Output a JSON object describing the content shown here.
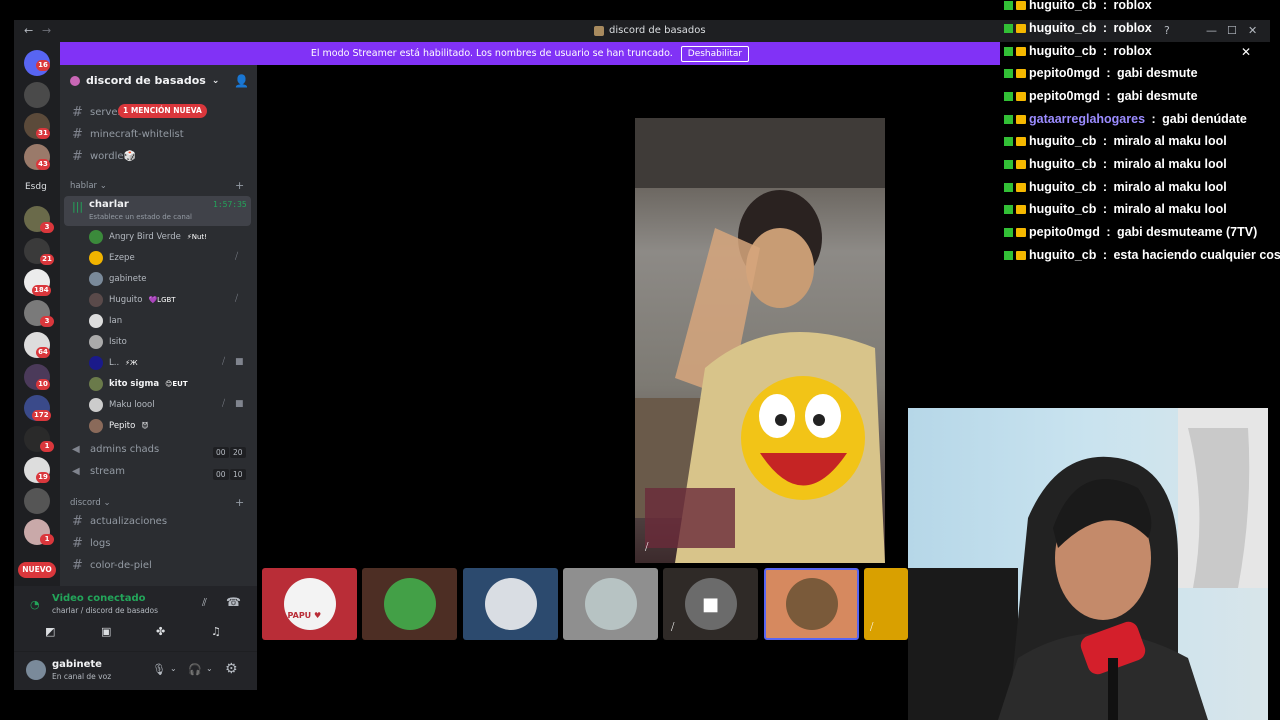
{
  "window": {
    "title": "discord de basados"
  },
  "streamer_banner": {
    "text": "El modo Streamer está habilitado. Los nombres de usuario se han truncado.",
    "button": "Deshabilitar"
  },
  "guilds": [
    {
      "badge": "16"
    },
    {
      "badge": ""
    },
    {
      "badge": "31"
    },
    {
      "badge": "43"
    },
    {
      "label": "Esdg"
    },
    {
      "badge": "3"
    },
    {
      "badge": "21"
    },
    {
      "badge": "184"
    },
    {
      "badge": "3"
    },
    {
      "badge": "64"
    },
    {
      "badge": "10"
    },
    {
      "badge": "172"
    },
    {
      "badge": "1"
    },
    {
      "badge": "19"
    },
    {
      "badge": ""
    },
    {
      "badge": "1"
    }
  ],
  "new_label": "NUEVO",
  "server": {
    "name": "discord de basados",
    "mention_badge": "1 MENCIÓN NUEVA",
    "channels_top": [
      {
        "name": "server"
      },
      {
        "name": "minecraft-whitelist"
      },
      {
        "name": "wordle🎲"
      }
    ],
    "cat_hablar": "hablar",
    "voice_active": {
      "name": "charlar",
      "status": "Establece un estado de canal",
      "timer": "1:57:35"
    },
    "voice_users": [
      {
        "name": "Angry Bird Verde",
        "tag": "⚡Nut!",
        "muted": true
      },
      {
        "name": "Ezepe",
        "tag": "",
        "muted": true
      },
      {
        "name": "gabinete",
        "tag": ""
      },
      {
        "name": "Huguito",
        "tag": "💜LGBT",
        "muted": true
      },
      {
        "name": "Ian",
        "tag": ""
      },
      {
        "name": "Isito",
        "tag": ""
      },
      {
        "name": "L..",
        "tag": "⚡Ж",
        "muted": true
      },
      {
        "name": "kito sigma",
        "tag": "😊EUT"
      },
      {
        "name": "Maku loool",
        "tag": "",
        "muted": true
      },
      {
        "name": "Pepito",
        "tag": "😈"
      }
    ],
    "voice_channels": [
      {
        "name": "admins chads",
        "a": "00",
        "b": "20"
      },
      {
        "name": "stream",
        "a": "00",
        "b": "10"
      }
    ],
    "cat_discord": "discord",
    "channels_bottom": [
      {
        "name": "actualizaciones"
      },
      {
        "name": "logs"
      },
      {
        "name": "color-de-piel"
      }
    ]
  },
  "voice_panel": {
    "status": "Video conectado",
    "location": "charlar / discord de basados"
  },
  "user_panel": {
    "name": "gabinete",
    "status": "En canal de voz"
  },
  "chat": [
    {
      "user": "huguito_cb",
      "msg": "roblox"
    },
    {
      "user": "huguito_cb",
      "msg": "roblox"
    },
    {
      "user": "huguito_cb",
      "msg": "roblox"
    },
    {
      "user": "pepito0mgd",
      "msg": "gabi desmute"
    },
    {
      "user": "pepito0mgd",
      "msg": "gabi desmute"
    },
    {
      "user": "gataarreglahogares",
      "msg": "gabi denúdate"
    },
    {
      "user": "huguito_cb",
      "msg": "miralo al maku lool"
    },
    {
      "user": "huguito_cb",
      "msg": "miralo al maku lool"
    },
    {
      "user": "huguito_cb",
      "msg": "miralo al maku lool"
    },
    {
      "user": "huguito_cb",
      "msg": "miralo al maku lool"
    },
    {
      "user": "pepito0mgd",
      "msg": "gabi desmuteame (7TV)"
    },
    {
      "user": "huguito_cb",
      "msg": "esta haciendo cualquier cosa"
    }
  ],
  "chat_colors": {
    "huguito_cb": "#f0f0f0",
    "pepito0mgd": "#f0f0f0",
    "gataarreglahogares": "#9b8cff"
  },
  "tile_badge": "PAPU ♥",
  "colors": {
    "accent": "#8132f6",
    "danger": "#da373c",
    "online": "#23a55a"
  }
}
